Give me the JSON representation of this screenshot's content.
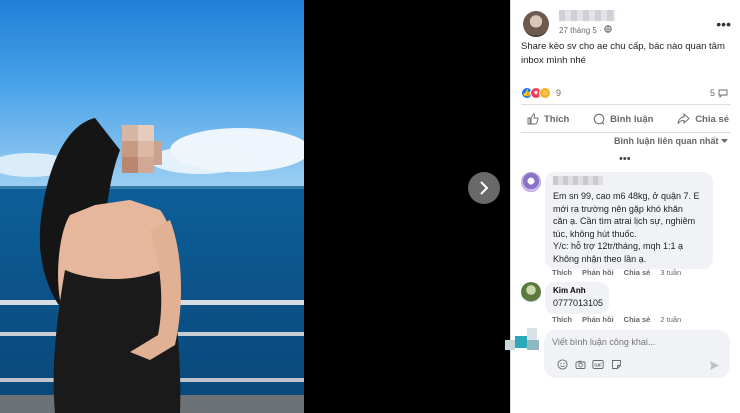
{
  "post": {
    "time": "27 tháng 5 · ",
    "text": "Share kèo sv cho ae chu cấp, bác nào quan tâm\ninbox mình nhé",
    "reaction_count": "9",
    "comment_count": "5"
  },
  "actions": {
    "like": "Thích",
    "comment": "Bình luận",
    "share": "Chia sẻ"
  },
  "sort_label": "Bình luận liên quan nhất",
  "comments": [
    {
      "name": "",
      "text": "Em sn 99, cao m6 48kg, ở quận 7. E\nmới ra trường nên gặp khó khăn\ncăn ạ. Cần tìm atrai lịch sự, nghiêm\ntúc, không hút thuốc.\nY/c: hỗ trợ 12tr/tháng, mqh 1:1 ạ\nKhông nhận theo lần ạ.",
      "like": "Thích",
      "reply": "Phản hồi",
      "share": "Chia sẻ",
      "time": "3 tuần"
    },
    {
      "name": "Kim Anh",
      "text": "0777013105",
      "like": "Thích",
      "reply": "Phản hồi",
      "share": "Chia sẻ",
      "time": "2 tuần"
    }
  ],
  "composer": {
    "placeholder": "Viết bình luận công khai..."
  },
  "colors": {
    "like_blue": "#1877f2",
    "love_red": "#f33e58",
    "haha_yellow": "#f7b125",
    "muted_text": "#65676b",
    "bubble_bg": "#f0f2f5"
  },
  "icons": [
    "chevron-right-icon",
    "globe-icon",
    "more-dots-icon",
    "like-icon",
    "comment-icon",
    "share-icon",
    "chevron-down-icon",
    "emoji-icon",
    "camera-icon",
    "gif-icon",
    "sticker-icon",
    "send-icon"
  ]
}
